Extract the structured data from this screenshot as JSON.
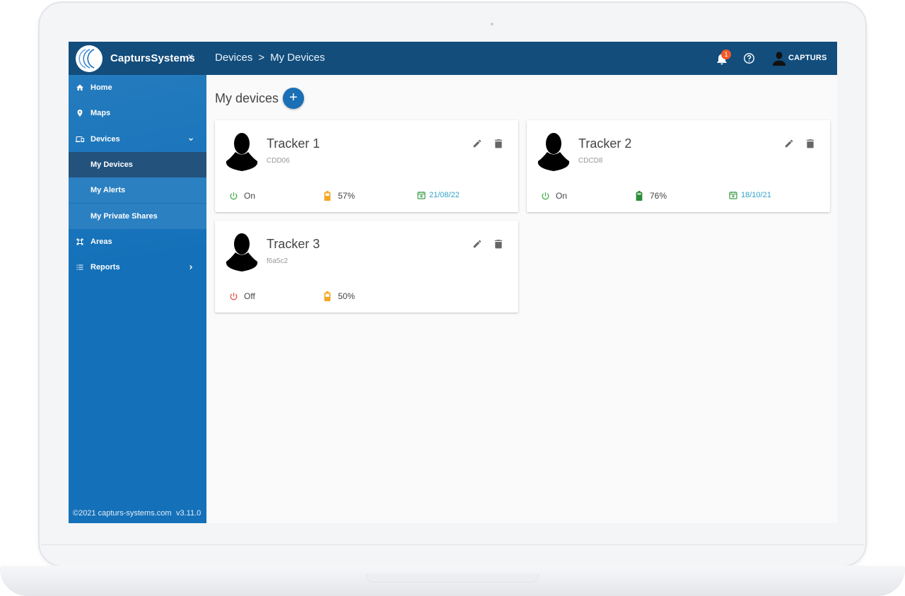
{
  "app": {
    "brand": "CaptursSystems",
    "close_glyph": "×"
  },
  "header": {
    "breadcrumb": [
      "Devices",
      ">",
      "My Devices"
    ],
    "notifications_count": "1",
    "user": "CAPTURS"
  },
  "sidebar": {
    "items": [
      {
        "label": "Home",
        "icon": "home-icon"
      },
      {
        "label": "Maps",
        "icon": "map-pin-icon"
      },
      {
        "label": "Devices",
        "icon": "devices-icon",
        "expanded": true
      },
      {
        "label": "Areas",
        "icon": "areas-icon"
      },
      {
        "label": "Reports",
        "icon": "list-icon"
      }
    ],
    "sub_items": [
      {
        "label": "My Devices",
        "active": true
      },
      {
        "label": "My Alerts"
      },
      {
        "label": "My Private Shares"
      }
    ],
    "footer": {
      "copyright": "©2021 capturs-systems.com",
      "version": "v3.11.0"
    }
  },
  "main": {
    "title": "My devices",
    "add_label": "+",
    "devices": [
      {
        "name": "Tracker 1",
        "code": "CDD06",
        "status": "On",
        "battery": "57%",
        "battery_level": 0.57,
        "date": "21/08/22"
      },
      {
        "name": "Tracker 2",
        "code": "CDCD8",
        "status": "On",
        "battery": "76%",
        "battery_level": 0.76,
        "date": "18/10/21"
      },
      {
        "name": "Tracker 3",
        "code": "f6a5c2",
        "status": "Off",
        "battery": "50%",
        "battery_level": 0.5,
        "date": ""
      }
    ]
  },
  "colors": {
    "topbar": "#124d7c",
    "sidebar": "#1471b9",
    "on": "#4caf50",
    "off": "#e8574a",
    "battery_orange": "#f5a623",
    "battery_green": "#2e8b3a",
    "date": "#2fa3c7",
    "calendar": "#3c9a48"
  }
}
